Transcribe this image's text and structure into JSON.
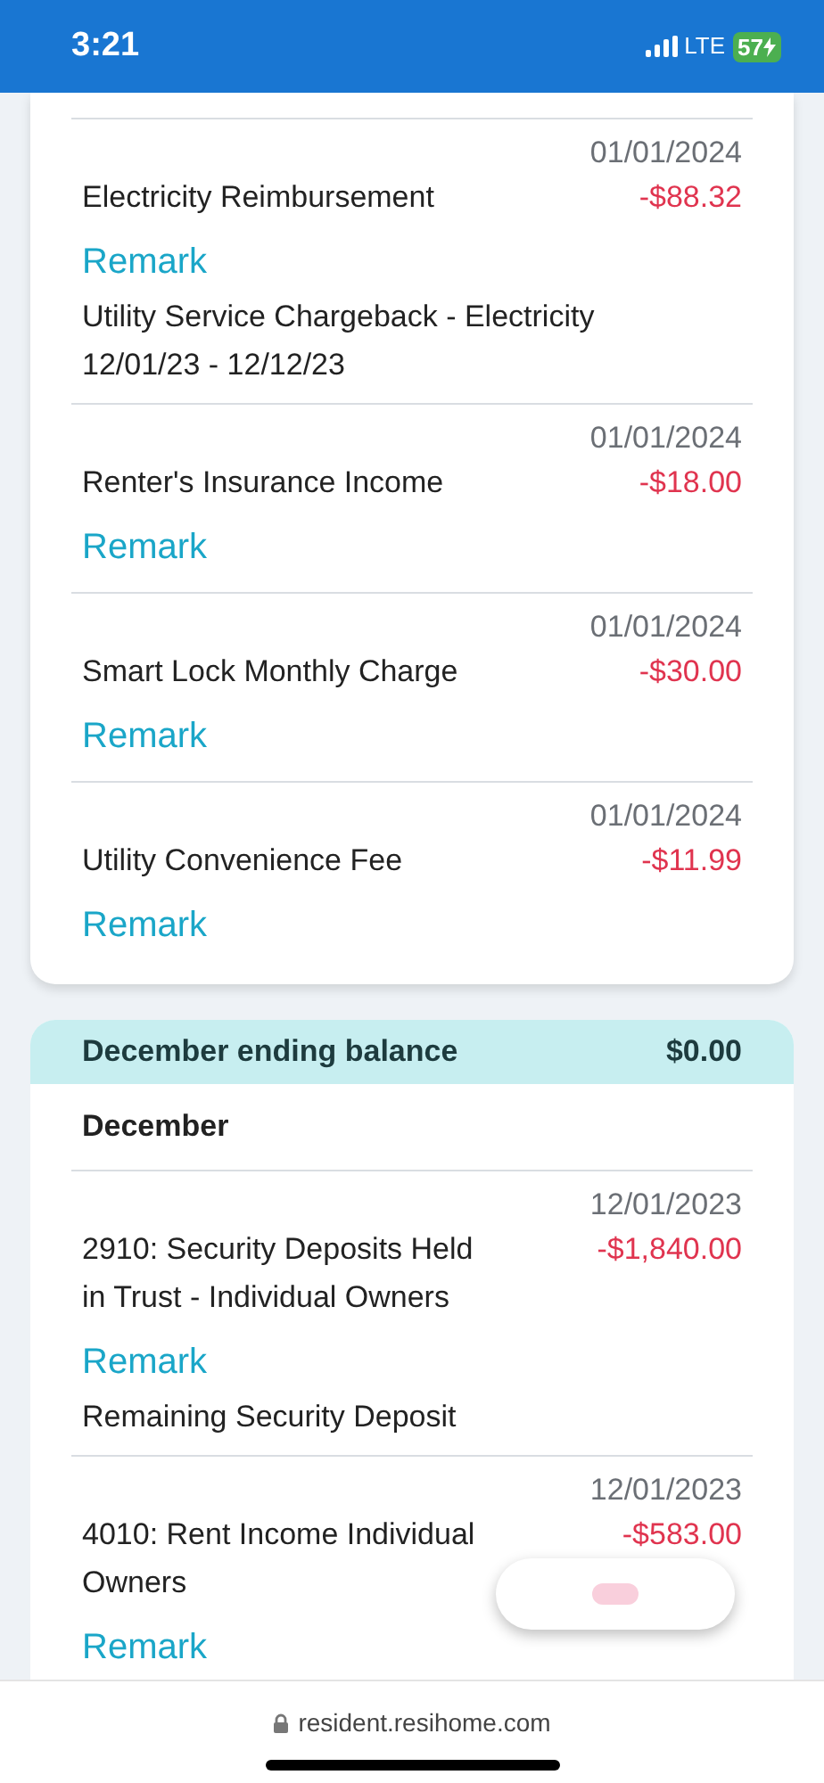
{
  "status_bar": {
    "time": "3:21",
    "network": "LTE",
    "battery": "57"
  },
  "sections": [
    {
      "transactions": [
        {
          "date": "01/01/2024",
          "description": "Electricity Reimbursement",
          "amount": "-$88.32",
          "remark": "Remark",
          "note": "Utility Service Chargeback - Electricity 12/01/23 - 12/12/23"
        },
        {
          "date": "01/01/2024",
          "description": "Renter's Insurance Income",
          "amount": "-$18.00",
          "remark": "Remark"
        },
        {
          "date": "01/01/2024",
          "description": "Smart Lock Monthly Charge",
          "amount": "-$30.00",
          "remark": "Remark"
        },
        {
          "date": "01/01/2024",
          "description": "Utility Convenience Fee",
          "amount": "-$11.99",
          "remark": "Remark"
        }
      ]
    },
    {
      "header": {
        "label": "December ending balance",
        "amount": "$0.00"
      },
      "month": "December",
      "transactions": [
        {
          "date": "12/01/2023",
          "description": "2910: Security Deposits Held in Trust - Individual Owners",
          "amount": "-$1,840.00",
          "remark": "Remark",
          "note": "Remaining Security Deposit"
        },
        {
          "date": "12/01/2023",
          "description": "4010: Rent Income Individual Owners",
          "amount": "-$583.00",
          "remark": "Remark"
        }
      ]
    }
  ],
  "address_bar": {
    "url": "resident.resihome.com"
  }
}
